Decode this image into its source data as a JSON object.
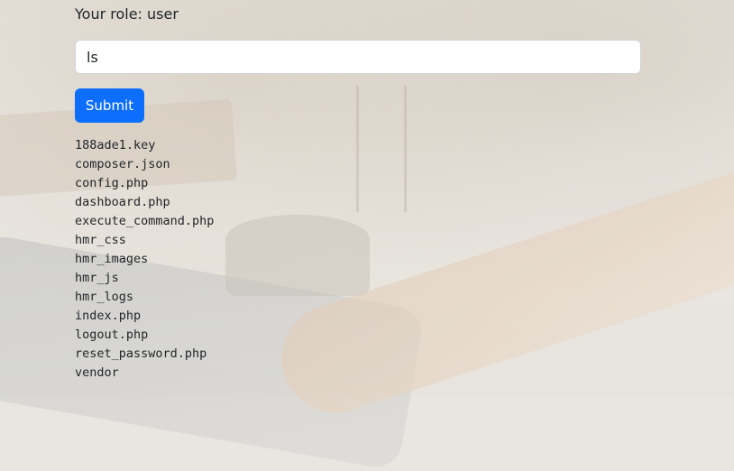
{
  "role": {
    "text": "Your role: user"
  },
  "command": {
    "value": "ls"
  },
  "form": {
    "submit_label": "Submit"
  },
  "output": {
    "lines": [
      "188ade1.key",
      "composer.json",
      "config.php",
      "dashboard.php",
      "execute_command.php",
      "hmr_css",
      "hmr_images",
      "hmr_js",
      "hmr_logs",
      "index.php",
      "logout.php",
      "reset_password.php",
      "vendor"
    ]
  },
  "colors": {
    "primary_button": "#0d6efd",
    "text": "#212529"
  }
}
